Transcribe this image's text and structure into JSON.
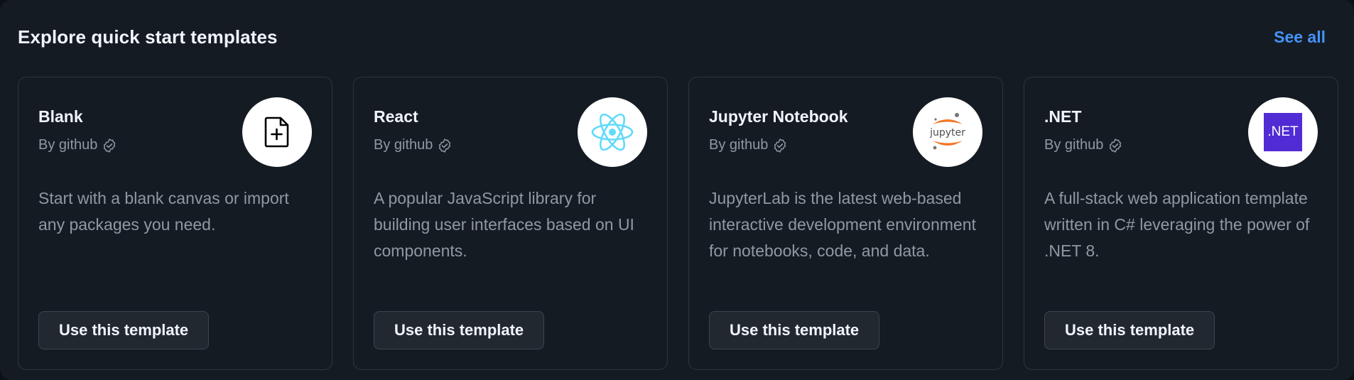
{
  "header": {
    "title": "Explore quick start templates",
    "see_all": "See all"
  },
  "templates": [
    {
      "title": "Blank",
      "author": "By github",
      "icon": "blank-file-plus-icon",
      "description": "Start with a blank canvas or import any packages you need.",
      "button": "Use this template"
    },
    {
      "title": "React",
      "author": "By github",
      "icon": "react-logo-icon",
      "icon_color": "#61dafb",
      "description": "A popular JavaScript library for building user interfaces based on UI components.",
      "button": "Use this template"
    },
    {
      "title": "Jupyter Notebook",
      "author": "By github",
      "icon": "jupyter-logo-icon",
      "logo_text": "jupyter",
      "icon_color": "#f37726",
      "description": "JupyterLab is the latest web-based interactive development environment for notebooks, code, and data.",
      "button": "Use this template"
    },
    {
      "title": ".NET",
      "author": "By github",
      "icon": "dotnet-logo-icon",
      "logo_text": ".NET",
      "icon_color": "#512bd4",
      "description": "A full-stack web application template written in C# leveraging the power of .NET 8.",
      "button": "Use this template"
    }
  ],
  "colors": {
    "background": "#151b23",
    "card_border": "#2f353d",
    "title_text": "#f0f6fc",
    "muted_text": "#9198a1",
    "link": "#4493f8",
    "button_bg": "#212830"
  }
}
